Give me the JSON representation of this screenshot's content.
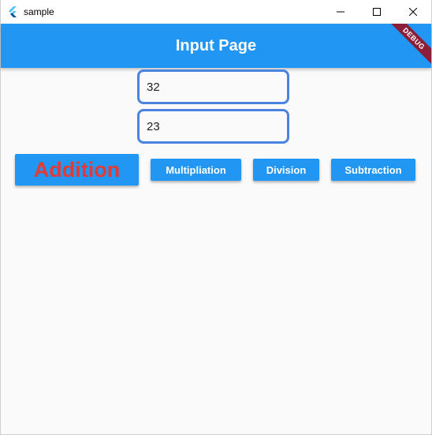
{
  "window": {
    "title": "sample",
    "icon": "flutter-icon",
    "controls": [
      "minimize-icon",
      "maximize-icon",
      "close-icon"
    ]
  },
  "appbar": {
    "title": "Input Page",
    "color": "#2196f3",
    "debug_banner": "DEBUG"
  },
  "inputs": {
    "first_value": "32",
    "second_value": "23",
    "border_color": "#4a84e0"
  },
  "buttons": {
    "addition": "Addition",
    "multiplication": "Multipliation",
    "division": "Division",
    "subtraction": "Subtraction",
    "addition_text_color": "#e53935"
  }
}
